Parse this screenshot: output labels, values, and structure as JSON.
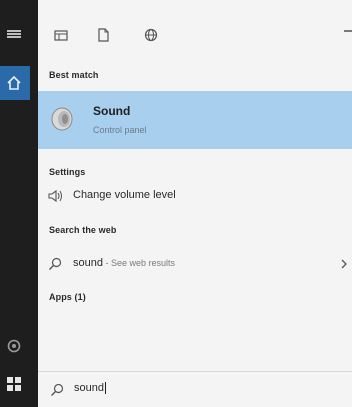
{
  "sections": {
    "best_match": "Best match",
    "settings": "Settings",
    "search_web": "Search the web",
    "apps": "Apps (1)"
  },
  "best_match_item": {
    "title": "Sound",
    "subtitle": "Control panel"
  },
  "settings_item": {
    "label": "Change volume level"
  },
  "web_item": {
    "query": "sound",
    "suffix": " - See web results"
  },
  "search_box": {
    "value": "sound"
  },
  "colors": {
    "rail": "#1e1e1e",
    "panel": "#f4f4f4",
    "highlight": "#a8cfee",
    "home_active": "#2b6aa8"
  }
}
